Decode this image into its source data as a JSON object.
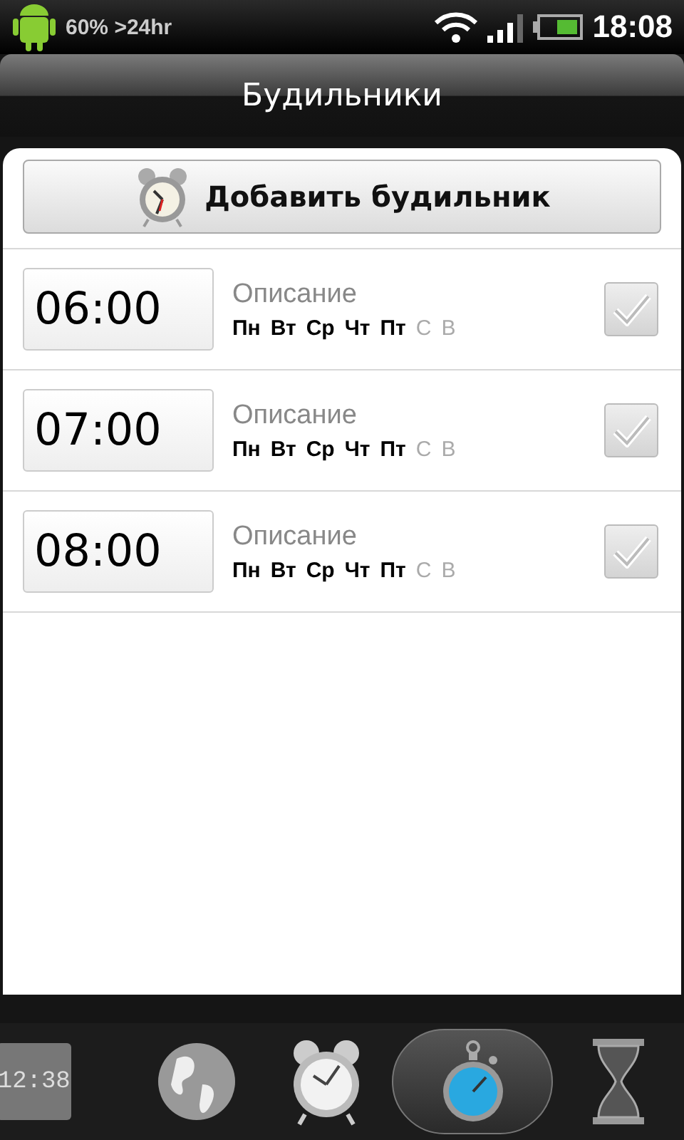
{
  "status_bar": {
    "battery_text": "60% >24hr",
    "time": "18:08"
  },
  "title": "Будильники",
  "add_button": {
    "label": "Добавить будильник"
  },
  "alarms": [
    {
      "time": "06:00",
      "description": "Описание",
      "checked": false,
      "days": [
        {
          "label": "Пн",
          "on": true
        },
        {
          "label": "Вт",
          "on": true
        },
        {
          "label": "Ср",
          "on": true
        },
        {
          "label": "Чт",
          "on": true
        },
        {
          "label": "Пт",
          "on": true
        },
        {
          "label": "С",
          "on": false
        },
        {
          "label": "В",
          "on": false
        }
      ]
    },
    {
      "time": "07:00",
      "description": "Описание",
      "checked": false,
      "days": [
        {
          "label": "Пн",
          "on": true
        },
        {
          "label": "Вт",
          "on": true
        },
        {
          "label": "Ср",
          "on": true
        },
        {
          "label": "Чт",
          "on": true
        },
        {
          "label": "Пт",
          "on": true
        },
        {
          "label": "С",
          "on": false
        },
        {
          "label": "В",
          "on": false
        }
      ]
    },
    {
      "time": "08:00",
      "description": "Описание",
      "checked": false,
      "days": [
        {
          "label": "Пн",
          "on": true
        },
        {
          "label": "Вт",
          "on": true
        },
        {
          "label": "Ср",
          "on": true
        },
        {
          "label": "Чт",
          "on": true
        },
        {
          "label": "Пт",
          "on": true
        },
        {
          "label": "С",
          "on": false
        },
        {
          "label": "В",
          "on": false
        }
      ]
    }
  ],
  "tabs": [
    {
      "kind": "digital",
      "text": "12:38",
      "selected": false
    },
    {
      "kind": "globe",
      "selected": false
    },
    {
      "kind": "alarm",
      "selected": false
    },
    {
      "kind": "stopwatch",
      "selected": true
    },
    {
      "kind": "hourglass",
      "selected": false
    }
  ]
}
